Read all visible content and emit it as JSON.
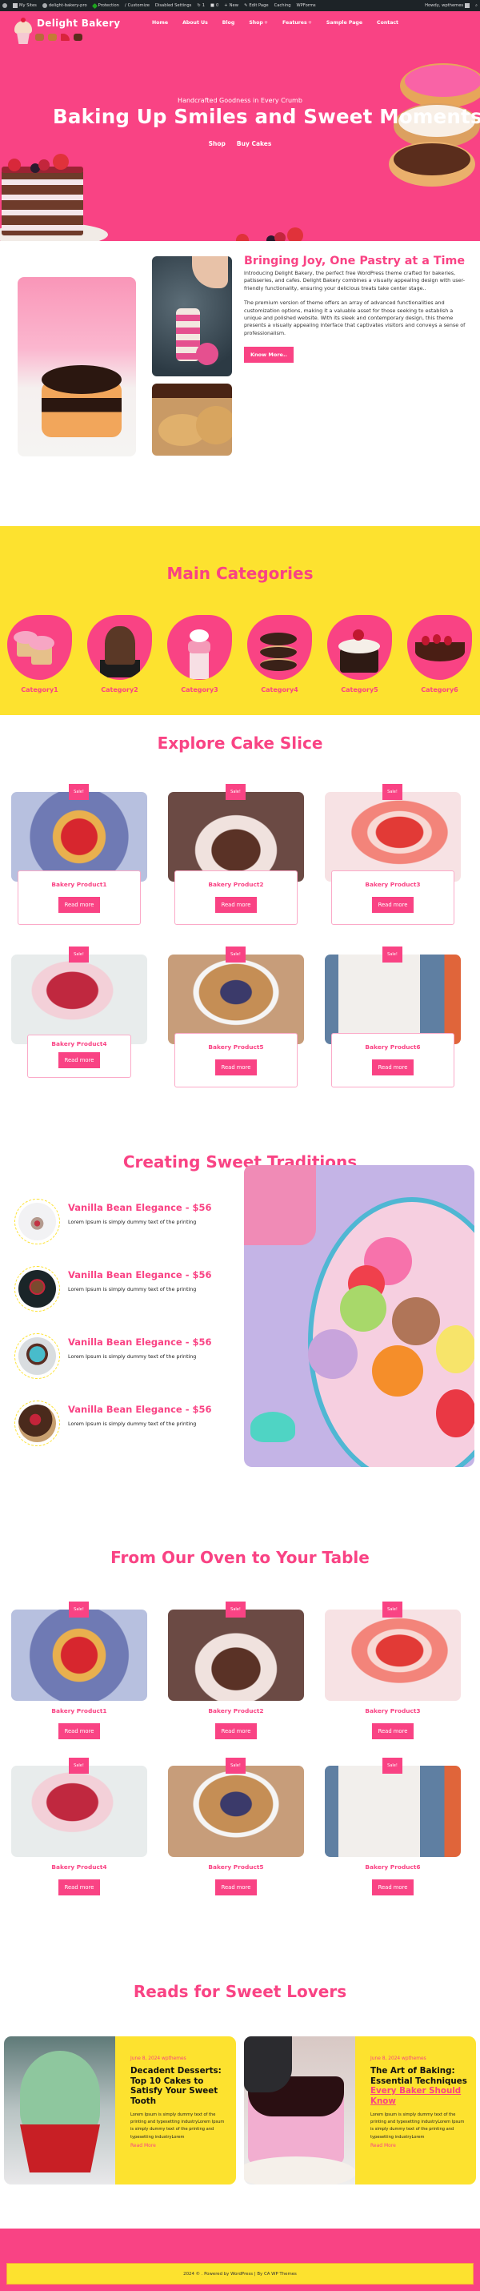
{
  "adminbar": {
    "items": [
      {
        "label": "",
        "icon": "wordpress-icon"
      },
      {
        "label": "My Sites",
        "icon": "my-sites-icon"
      },
      {
        "label": "delight-bakery-pro",
        "icon": "site-home-icon"
      },
      {
        "label": "Protection",
        "icon": "shield-leaf-icon"
      },
      {
        "label": "Customize",
        "icon": "brush-icon"
      },
      {
        "label": "Disabled Settings",
        "icon": ""
      },
      {
        "label": "1",
        "icon": "updates-icon"
      },
      {
        "label": "0",
        "icon": "comments-icon"
      },
      {
        "label": "New",
        "icon": "plus-icon"
      },
      {
        "label": "Edit Page",
        "icon": "pencil-icon"
      },
      {
        "label": "Caching",
        "icon": ""
      },
      {
        "label": "WPForms",
        "icon": ""
      }
    ],
    "howdy": "Howdy, wpthemes"
  },
  "header": {
    "site_title": "Delight Bakery",
    "nav": [
      {
        "label": "Home",
        "has_sub": false
      },
      {
        "label": "About Us",
        "has_sub": false
      },
      {
        "label": "Blog",
        "has_sub": false
      },
      {
        "label": "Shop",
        "has_sub": true
      },
      {
        "label": "Features",
        "has_sub": true
      },
      {
        "label": "Sample Page",
        "has_sub": false
      },
      {
        "label": "Contact",
        "has_sub": false
      }
    ],
    "submenu_indicator": "+"
  },
  "hero": {
    "subtitle": "Handcrafted Goodness in Every Crumb",
    "title": "Baking Up Smiles and Sweet Moments",
    "links": [
      "Shop",
      "Buy Cakes"
    ]
  },
  "about": {
    "title": "Bringing Joy, One Pastry at a Time",
    "paragraphs": [
      "Introducing Delight Bakery, the perfect free WordPress theme crafted for bakeries, patisseries, and cafes. Delight Bakery combines a visually appealing design with user-friendly functionality, ensuring your delicious treats take center stage..",
      "The premium version of theme offers an array of advanced functionalities and customization options, making it a valuable asset for those seeking to establish a unique and polished website. With its sleek and contemporary design, this theme presents a visually appealing interface that captivates visitors and conveys a sense of professionalism."
    ],
    "button": "Know More.."
  },
  "categories": {
    "title": "Main Categories",
    "items": [
      "Category1",
      "Category2",
      "Category3",
      "Category4",
      "Category5",
      "Category6"
    ]
  },
  "explore": {
    "title": "Explore Cake Slice",
    "products": [
      {
        "name": "Bakery Product1",
        "badge": "Sale!",
        "button": "Read more"
      },
      {
        "name": "Bakery Product2",
        "badge": "Sale!",
        "button": "Read more"
      },
      {
        "name": "Bakery Product3",
        "badge": "Sale!",
        "button": "Read more"
      },
      {
        "name": "Bakery Product4",
        "badge": "Sale!",
        "button": "Read more"
      },
      {
        "name": "Bakery Product5",
        "badge": "Sale!",
        "button": "Read more"
      },
      {
        "name": "Bakery Product6",
        "badge": "Sale!",
        "button": "Read more"
      }
    ]
  },
  "traditions": {
    "title": "Creating Sweet Traditions",
    "items": [
      {
        "title": "Vanilla Bean Elegance - $56",
        "desc": "Lorem Ipsum is simply dummy text of the printing"
      },
      {
        "title": "Vanilla Bean Elegance - $56",
        "desc": "Lorem Ipsum is simply dummy text of the printing"
      },
      {
        "title": "Vanilla Bean Elegance - $56",
        "desc": "Lorem Ipsum is simply dummy text of the printing"
      },
      {
        "title": "Vanilla Bean Elegance - $56",
        "desc": "Lorem Ipsum is simply dummy text of the printing"
      }
    ]
  },
  "oven": {
    "title": "From Our Oven to Your Table",
    "products": [
      {
        "name": "Bakery Product1",
        "badge": "Sale!",
        "button": "Read more"
      },
      {
        "name": "Bakery Product2",
        "badge": "Sale!",
        "button": "Read more"
      },
      {
        "name": "Bakery Product3",
        "badge": "Sale!",
        "button": "Read more"
      },
      {
        "name": "Bakery Product4",
        "badge": "Sale!",
        "button": "Read more"
      },
      {
        "name": "Bakery Product5",
        "badge": "Sale!",
        "button": "Read more"
      },
      {
        "name": "Bakery Product6",
        "badge": "Sale!",
        "button": "Read more"
      }
    ]
  },
  "reads": {
    "title": "Reads for Sweet Lovers",
    "posts": [
      {
        "meta": "June 8, 2024 wpthemes",
        "title": "Decadent Desserts: Top 10 Cakes to Satisfy Your Sweet Tooth",
        "title_link": "",
        "excerpt": "Lorem Ipsum is simply dummy text of the printing and typesetting industryLorem Ipsum is simply dummy text of the printing and typesetting industryLorem",
        "more": "Read More"
      },
      {
        "meta": "June 8, 2024 wpthemes",
        "title": "The Art of Baking: Essential Techniques",
        "title_link": "Every Baker Should Know",
        "excerpt": "Lorem Ipsum is simply dummy text of the printing and typesetting industryLorem Ipsum is simply dummy text of the printing and typesetting industryLorem",
        "more": "Read More"
      }
    ]
  },
  "footer": {
    "copyright": "2024 © . Powered by WordPress | By CA WP Themes"
  },
  "colors": {
    "primary_pink": "#f94384",
    "accent_yellow": "#fde22f",
    "admin_bar": "#1d2327"
  }
}
